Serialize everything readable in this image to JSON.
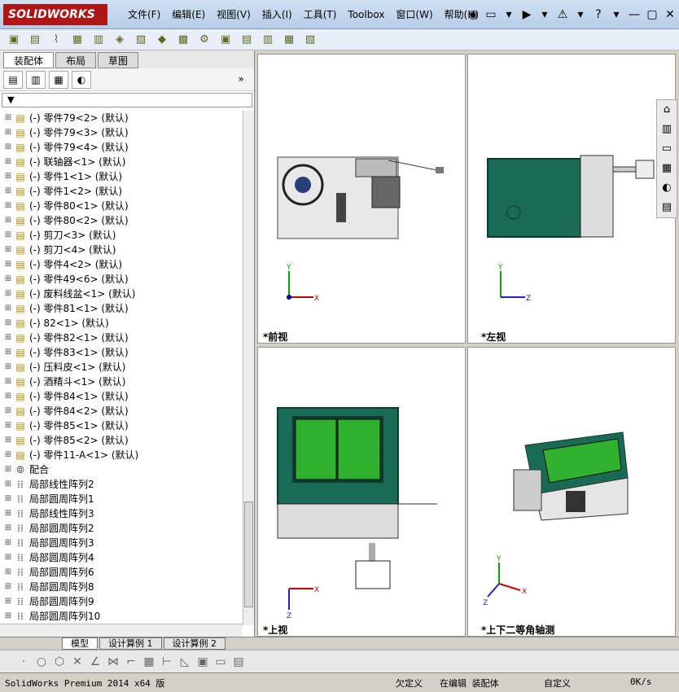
{
  "app": {
    "logo": "SOLIDWORKS"
  },
  "menu": [
    "文件(F)",
    "编辑(E)",
    "视图(V)",
    "插入(I)",
    "工具(T)",
    "Toolbox",
    "窗口(W)",
    "帮助(H)"
  ],
  "titlebar_icons": [
    "◉",
    "▭",
    "▾",
    "▶",
    "▾",
    "⚠",
    "▾",
    "?",
    "▾",
    "—",
    "▢",
    "✕"
  ],
  "toolbar_icons": [
    "▣",
    "▤",
    "⌇",
    "▦",
    "▥",
    "◈",
    "▧",
    "◆",
    "▩",
    "⚙",
    "▣",
    "▤",
    "▥",
    "▦",
    "▧"
  ],
  "left_tabs": [
    "装配体",
    "布局",
    "草图"
  ],
  "manager_icons": [
    "▤",
    "▥",
    "▦",
    "◐"
  ],
  "manager_expand": "»",
  "filter_icon": "▼",
  "tree": [
    {
      "label": "(-) 零件79<2> (默认)",
      "type": "part"
    },
    {
      "label": "(-) 零件79<3> (默认)",
      "type": "part"
    },
    {
      "label": "(-) 零件79<4> (默认)",
      "type": "part"
    },
    {
      "label": "(-) 联轴器<1> (默认)",
      "type": "part"
    },
    {
      "label": "(-) 零件1<1> (默认)",
      "type": "part"
    },
    {
      "label": "(-) 零件1<2> (默认)",
      "type": "part"
    },
    {
      "label": "(-) 零件80<1> (默认)",
      "type": "part"
    },
    {
      "label": "(-) 零件80<2> (默认)",
      "type": "part"
    },
    {
      "label": "(-) 剪刀<3> (默认)",
      "type": "part"
    },
    {
      "label": "(-) 剪刀<4> (默认)",
      "type": "part"
    },
    {
      "label": "(-) 零件4<2> (默认)",
      "type": "part"
    },
    {
      "label": "(-) 零件49<6> (默认)",
      "type": "part"
    },
    {
      "label": "(-) 废料线盆<1> (默认)",
      "type": "part"
    },
    {
      "label": "(-) 零件81<1> (默认)",
      "type": "part"
    },
    {
      "label": "(-) 82<1> (默认)",
      "type": "part"
    },
    {
      "label": "(-) 零件82<1> (默认)",
      "type": "part"
    },
    {
      "label": "(-) 零件83<1> (默认)",
      "type": "part"
    },
    {
      "label": "(-) 压料皮<1> (默认)",
      "type": "part"
    },
    {
      "label": "(-) 酒精斗<1> (默认)",
      "type": "part"
    },
    {
      "label": "(-) 零件84<1> (默认)",
      "type": "part"
    },
    {
      "label": "(-) 零件84<2> (默认)",
      "type": "part"
    },
    {
      "label": "(-) 零件85<1> (默认)",
      "type": "part"
    },
    {
      "label": "(-) 零件85<2> (默认)",
      "type": "part"
    },
    {
      "label": "(-) 零件11-A<1> (默认)",
      "type": "part"
    },
    {
      "label": "配合",
      "type": "mate"
    },
    {
      "label": "局部线性阵列2",
      "type": "pattern"
    },
    {
      "label": "局部圆周阵列1",
      "type": "pattern"
    },
    {
      "label": "局部线性阵列3",
      "type": "pattern"
    },
    {
      "label": "局部圆周阵列2",
      "type": "pattern"
    },
    {
      "label": "局部圆周阵列3",
      "type": "pattern"
    },
    {
      "label": "局部圆周阵列4",
      "type": "pattern"
    },
    {
      "label": "局部圆周阵列6",
      "type": "pattern"
    },
    {
      "label": "局部圆周阵列8",
      "type": "pattern"
    },
    {
      "label": "局部圆周阵列9",
      "type": "pattern"
    },
    {
      "label": "局部圆周阵列10",
      "type": "pattern"
    }
  ],
  "viewports": [
    {
      "label": "*前视",
      "axes": "XY"
    },
    {
      "label": "*左视",
      "axes": "ZY"
    },
    {
      "label": "*上视",
      "axes": "XZ"
    },
    {
      "label": "*上下二等角轴测",
      "axes": "XYZ"
    }
  ],
  "bottom_tabs": [
    "模型",
    "设计算例 1",
    "设计算例 2"
  ],
  "status": {
    "product": "SolidWorks Premium 2014 x64 版",
    "defined": "欠定义",
    "editing": "在编辑 装配体",
    "custom": "自定义",
    "speed": "0K/s"
  },
  "colors": {
    "accent": "#1a6b55",
    "panel": "#2f8a62",
    "green": "#2fb12f",
    "brand": "#b01515"
  }
}
